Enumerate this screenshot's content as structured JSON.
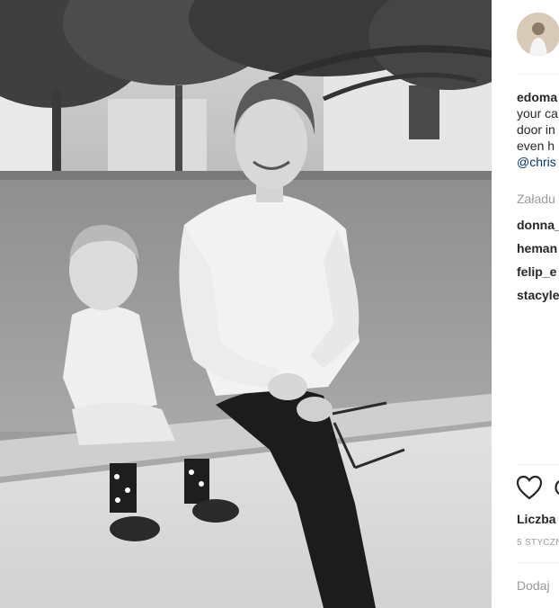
{
  "photo": {
    "alt_icon": "black-and-white-photo"
  },
  "post": {
    "username": "edoma",
    "caption_lines": [
      "your ca",
      "door in",
      "even h"
    ],
    "mention": "@chris"
  },
  "load_more_label": "Załadu",
  "comments": [
    {
      "user": "donna_"
    },
    {
      "user": "heman"
    },
    {
      "user": "felip_e"
    },
    {
      "user": "stacyle"
    }
  ],
  "actions": {
    "like_icon": "heart-icon",
    "comment_icon": "comment-icon"
  },
  "likes_label": "Liczba",
  "date_label": "5 STYCZN",
  "add_comment_placeholder": "Dodaj"
}
